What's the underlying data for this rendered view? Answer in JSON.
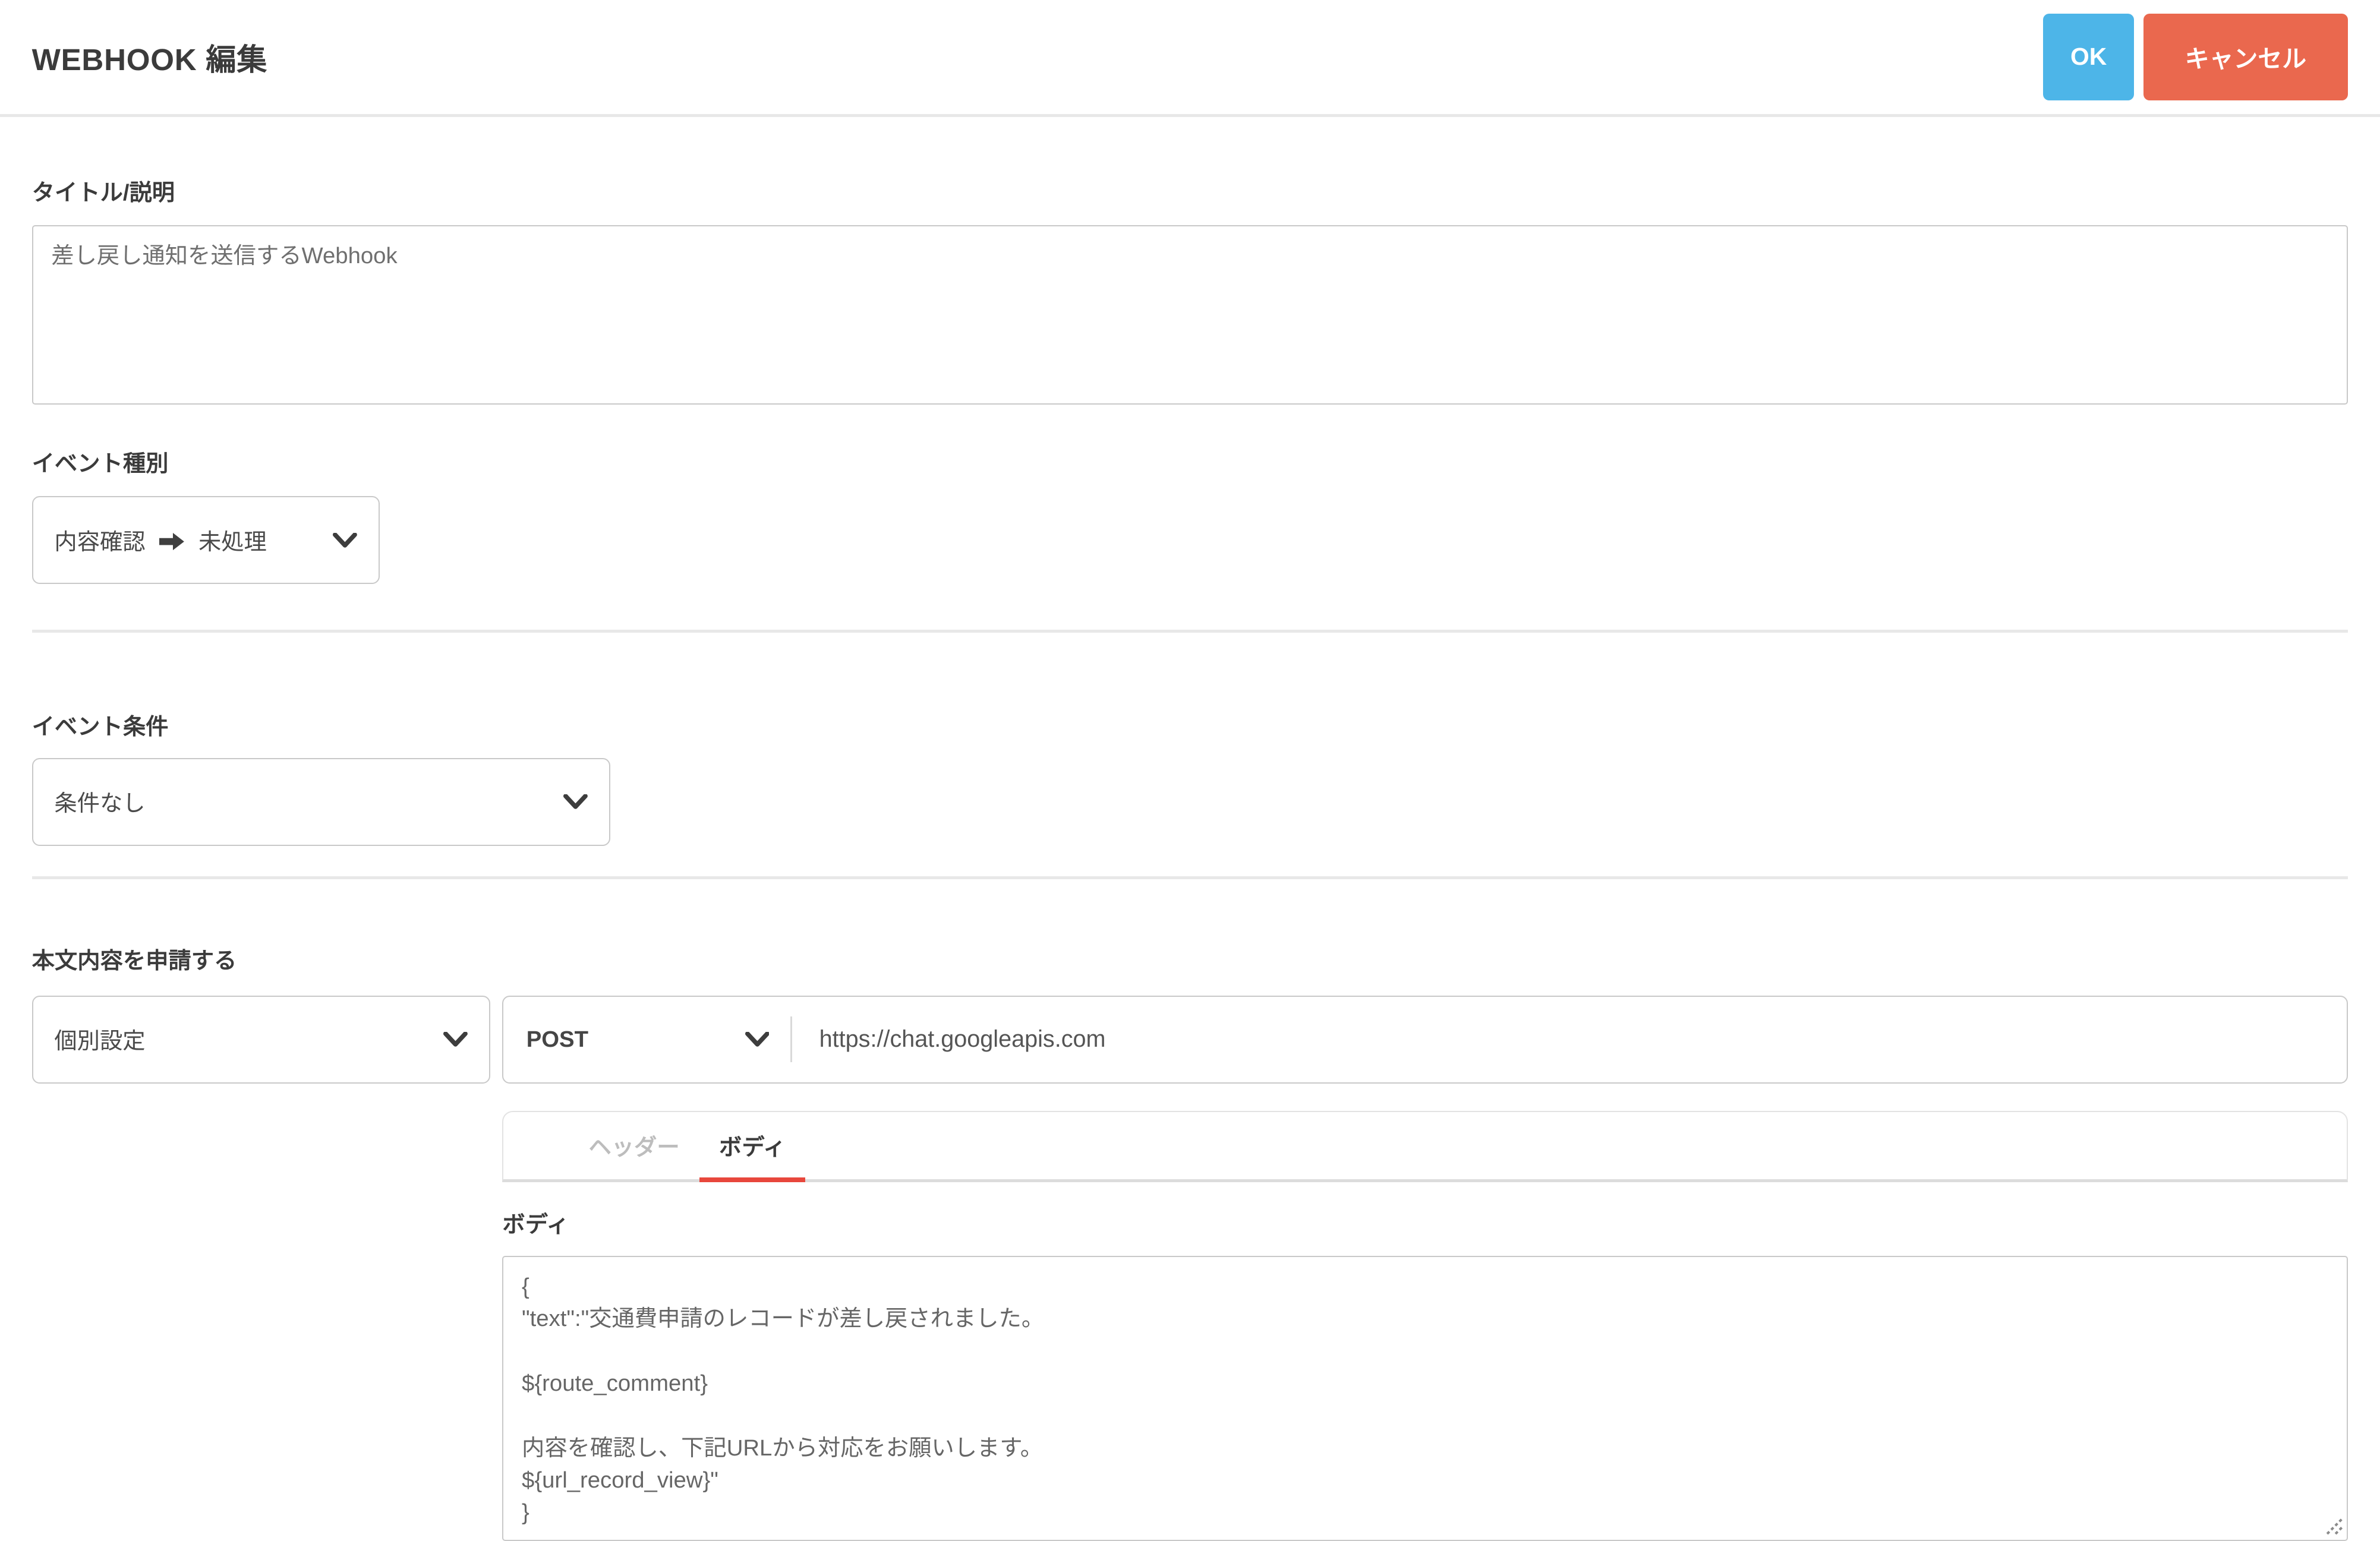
{
  "header": {
    "title": "WEBHOOK 編集",
    "ok_label": "OK",
    "cancel_label": "キャンセル"
  },
  "fields": {
    "title": {
      "label": "タイトル/説明",
      "value": "差し戻し通知を送信するWebhook"
    },
    "event_type": {
      "label": "イベント種別",
      "value_from": "内容確認",
      "value_to": "未処理"
    },
    "event_condition": {
      "label": "イベント条件",
      "value": "条件なし"
    },
    "request": {
      "label": "本文内容を申請する",
      "mode_value": "個別設定",
      "method_value": "POST",
      "url_value": "https://chat.googleapis.com",
      "tabs": [
        {
          "label": "ヘッダー",
          "active": false
        },
        {
          "label": "ボディ",
          "active": true
        }
      ],
      "body_label": "ボディ",
      "body_value": "{\n\"text\":\"交通費申請のレコードが差し戻されました。\n\n${route_comment}\n\n内容を確認し、下記URLから対応をお願いします。\n${url_record_view}\"\n}"
    }
  },
  "colors": {
    "ok_button": "#4db5e8",
    "cancel_button": "#ea684e",
    "active_tab_underline": "#e8473c",
    "label_text": "#3b3b3b",
    "input_border": "#c9c9c9"
  }
}
